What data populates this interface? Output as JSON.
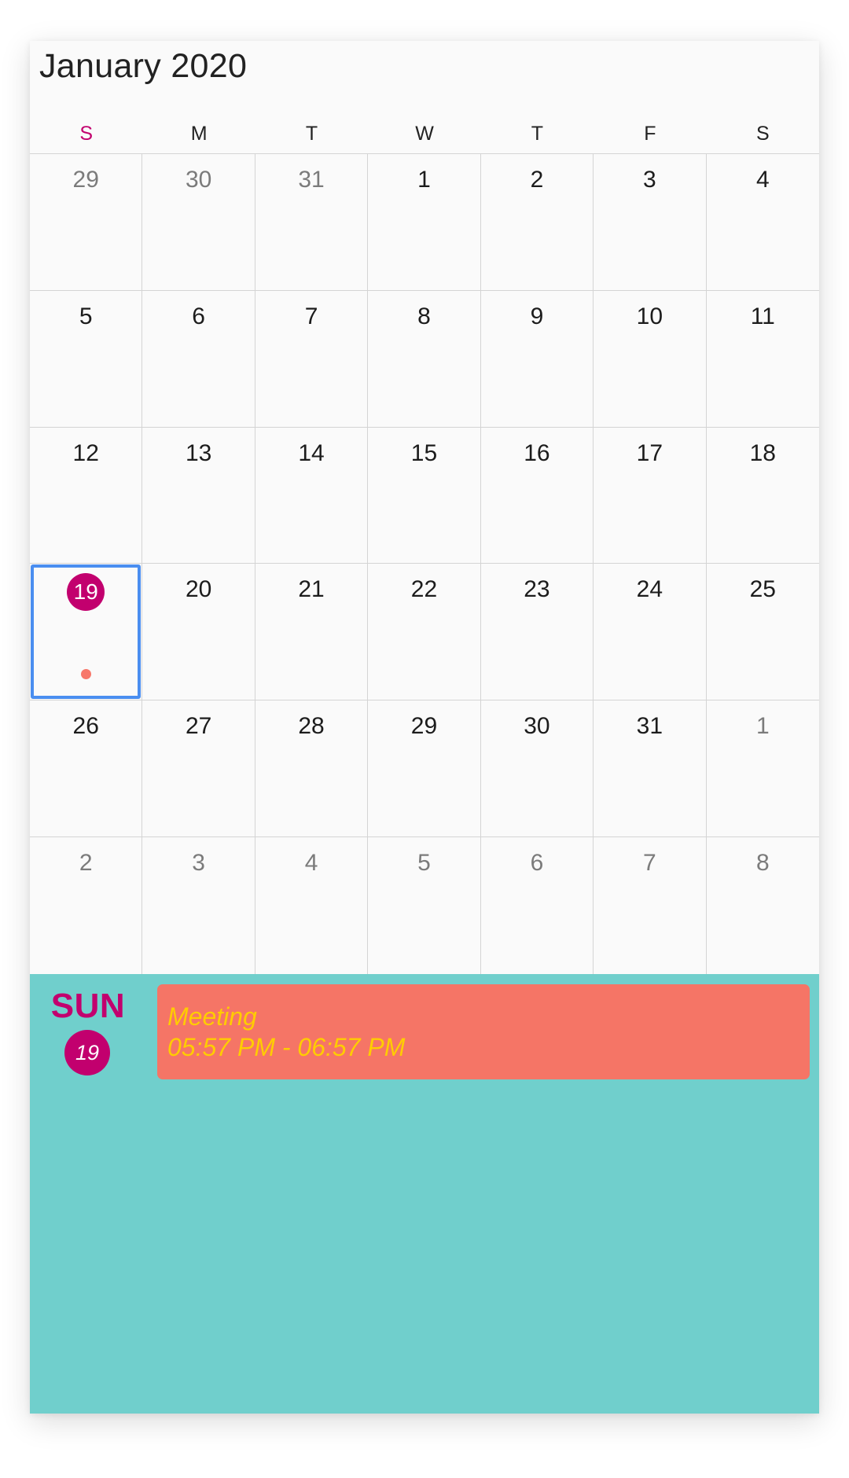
{
  "calendar": {
    "month_title": "January 2020",
    "weekdays": [
      "S",
      "M",
      "T",
      "W",
      "T",
      "F",
      "S"
    ],
    "weeks": [
      [
        {
          "day": "29",
          "current_month": false
        },
        {
          "day": "30",
          "current_month": false
        },
        {
          "day": "31",
          "current_month": false
        },
        {
          "day": "1",
          "current_month": true
        },
        {
          "day": "2",
          "current_month": true
        },
        {
          "day": "3",
          "current_month": true
        },
        {
          "day": "4",
          "current_month": true
        }
      ],
      [
        {
          "day": "5",
          "current_month": true
        },
        {
          "day": "6",
          "current_month": true
        },
        {
          "day": "7",
          "current_month": true
        },
        {
          "day": "8",
          "current_month": true
        },
        {
          "day": "9",
          "current_month": true
        },
        {
          "day": "10",
          "current_month": true
        },
        {
          "day": "11",
          "current_month": true
        }
      ],
      [
        {
          "day": "12",
          "current_month": true
        },
        {
          "day": "13",
          "current_month": true
        },
        {
          "day": "14",
          "current_month": true
        },
        {
          "day": "15",
          "current_month": true
        },
        {
          "day": "16",
          "current_month": true
        },
        {
          "day": "17",
          "current_month": true
        },
        {
          "day": "18",
          "current_month": true
        }
      ],
      [
        {
          "day": "19",
          "current_month": true,
          "today": true,
          "selected": true,
          "has_event": true
        },
        {
          "day": "20",
          "current_month": true
        },
        {
          "day": "21",
          "current_month": true
        },
        {
          "day": "22",
          "current_month": true
        },
        {
          "day": "23",
          "current_month": true
        },
        {
          "day": "24",
          "current_month": true
        },
        {
          "day": "25",
          "current_month": true
        }
      ],
      [
        {
          "day": "26",
          "current_month": true
        },
        {
          "day": "27",
          "current_month": true
        },
        {
          "day": "28",
          "current_month": true
        },
        {
          "day": "29",
          "current_month": true
        },
        {
          "day": "30",
          "current_month": true
        },
        {
          "day": "31",
          "current_month": true
        },
        {
          "day": "1",
          "current_month": false
        }
      ],
      [
        {
          "day": "2",
          "current_month": false
        },
        {
          "day": "3",
          "current_month": false
        },
        {
          "day": "4",
          "current_month": false
        },
        {
          "day": "5",
          "current_month": false
        },
        {
          "day": "6",
          "current_month": false
        },
        {
          "day": "7",
          "current_month": false
        },
        {
          "day": "8",
          "current_month": false
        }
      ]
    ]
  },
  "agenda": {
    "day_name": "SUN",
    "day_number": "19",
    "appointments": [
      {
        "subject": "Meeting",
        "time": "05:57 PM - 06:57 PM"
      }
    ]
  },
  "colors": {
    "accent": "#c2006e",
    "selection_border": "#4a8ef0",
    "appointment_background": "#f57566",
    "appointment_text": "#ffcc00",
    "agenda_background": "#70cfcc",
    "event_dot": "#f7776a"
  }
}
